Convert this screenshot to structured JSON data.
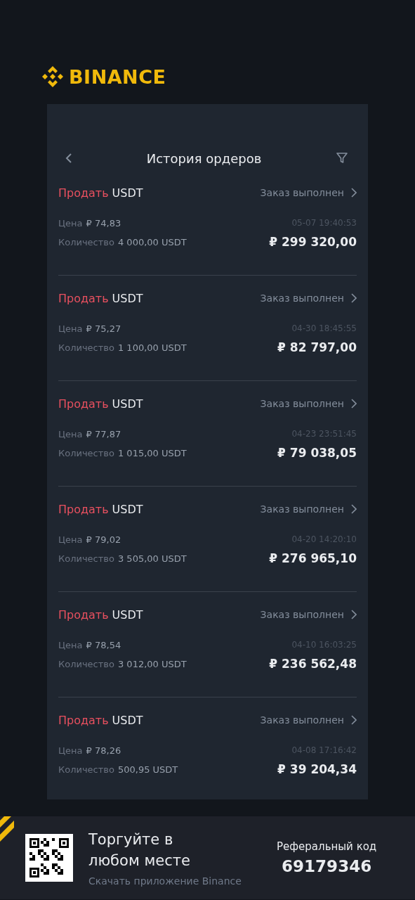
{
  "logo": {
    "text": "BINANCE"
  },
  "header": {
    "title": "История ордеров"
  },
  "orders": [
    {
      "kind": "sell",
      "side": "Продать",
      "asset": "USDT",
      "status": "Заказ выполнен",
      "price_label": "Цена",
      "price": "₽ 74,83",
      "time": "05-07 19:40:53",
      "quantity_label": "Количество",
      "quantity": "4 000,00 USDT",
      "total": "₽ 299 320,00"
    },
    {
      "kind": "sell",
      "side": "Продать",
      "asset": "USDT",
      "status": "Заказ выполнен",
      "price_label": "Цена",
      "price": "₽ 75,27",
      "time": "04-30 18:45:55",
      "quantity_label": "Количество",
      "quantity": "1 100,00 USDT",
      "total": "₽ 82 797,00"
    },
    {
      "kind": "sell",
      "side": "Продать",
      "asset": "USDT",
      "status": "Заказ выполнен",
      "price_label": "Цена",
      "price": "₽ 77,87",
      "time": "04-23 23:51:45",
      "quantity_label": "Количество",
      "quantity": "1 015,00 USDT",
      "total": "₽ 79 038,05"
    },
    {
      "kind": "sell",
      "side": "Продать",
      "asset": "USDT",
      "status": "Заказ выполнен",
      "price_label": "Цена",
      "price": "₽ 79,02",
      "time": "04-20 14:20:10",
      "quantity_label": "Количество",
      "quantity": "3 505,00 USDT",
      "total": "₽ 276 965,10"
    },
    {
      "kind": "sell",
      "side": "Продать",
      "asset": "USDT",
      "status": "Заказ выполнен",
      "price_label": "Цена",
      "price": "₽ 78,54",
      "time": "04-10 16:03:25",
      "quantity_label": "Количество",
      "quantity": "3 012,00 USDT",
      "total": "₽ 236 562,48"
    },
    {
      "kind": "sell",
      "side": "Продать",
      "asset": "USDT",
      "status": "Заказ выполнен",
      "price_label": "Цена",
      "price": "₽ 78,26",
      "time": "04-08 17:16:42",
      "quantity_label": "Количество",
      "quantity": "500,95 USDT",
      "total": "₽ 39 204,34"
    }
  ],
  "footer": {
    "headline": "Торгуйте в любом месте",
    "subtitle": "Скачать приложение Binance",
    "referral_label": "Реферальный код",
    "referral_code": "69179346"
  }
}
